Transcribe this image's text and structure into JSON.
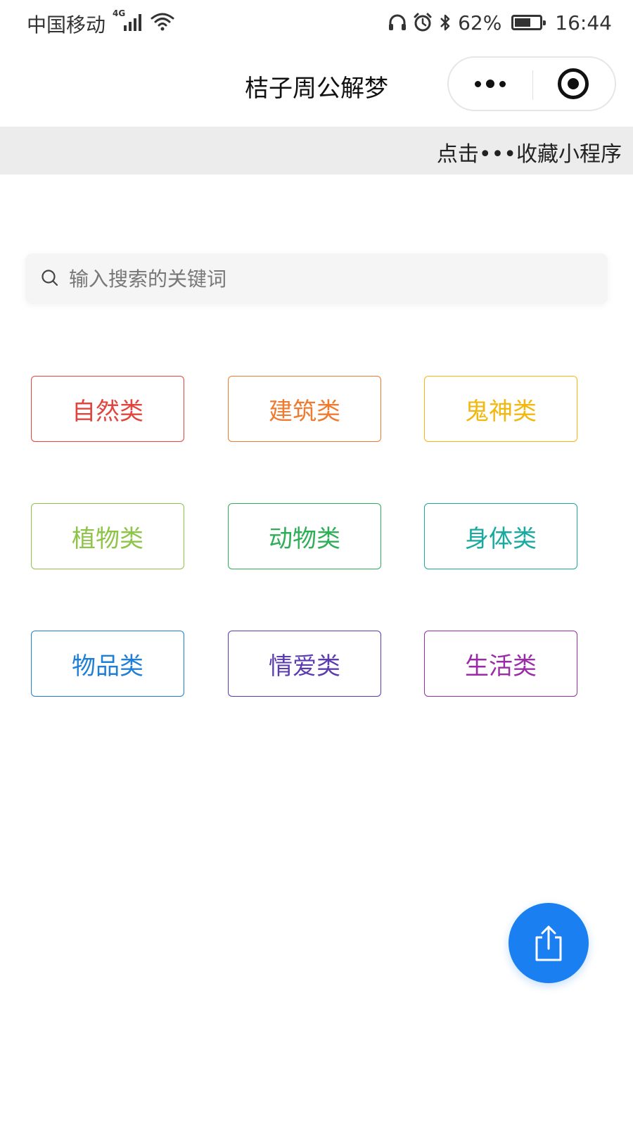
{
  "status_bar": {
    "carrier": "中国移动",
    "network": "4G",
    "battery": "62%",
    "battery_level": 0.62,
    "time": "16:44",
    "icons": [
      "headphones-icon",
      "alarm-icon",
      "bluetooth-icon",
      "signal-icon",
      "wifi-icon",
      "battery-icon"
    ]
  },
  "nav": {
    "title": "桔子周公解梦",
    "more_icon": "more-dots-icon",
    "close_icon": "target-icon"
  },
  "hint": {
    "text": "点击•••收藏小程序"
  },
  "search": {
    "placeholder": "输入搜索的关键词",
    "value": "",
    "icon": "search-icon"
  },
  "categories": [
    {
      "label": "自然类",
      "color": "#e0463f"
    },
    {
      "label": "建筑类",
      "color": "#ee7b30"
    },
    {
      "label": "鬼神类",
      "color": "#f2b80f"
    },
    {
      "label": "植物类",
      "color": "#8ec447"
    },
    {
      "label": "动物类",
      "color": "#2fae58"
    },
    {
      "label": "身体类",
      "color": "#17aaa0"
    },
    {
      "label": "物品类",
      "color": "#1f7fd6"
    },
    {
      "label": "情爱类",
      "color": "#5b3bb0"
    },
    {
      "label": "生活类",
      "color": "#9b2ca8"
    }
  ],
  "share_button": {
    "icon": "share-icon",
    "color": "#1a7ff0"
  }
}
